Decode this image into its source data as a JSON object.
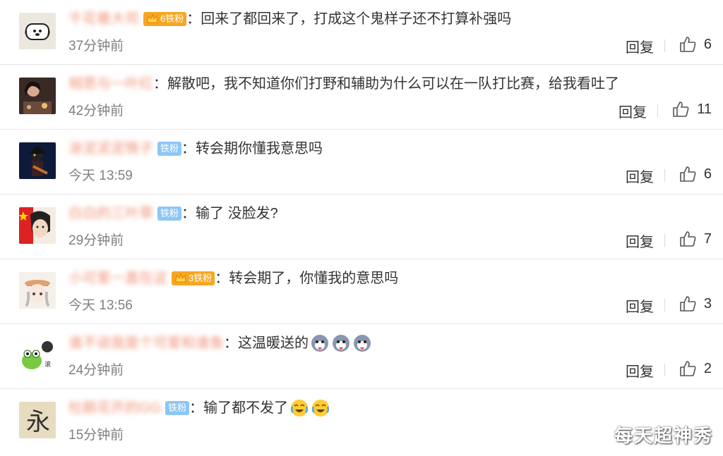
{
  "comments": [
    {
      "user": "千花巷大司",
      "badge": "铁粉",
      "badge_level": "6",
      "text": "：回来了都回来了，打成这个鬼样子还不打算补强吗",
      "time": "37分钟前",
      "reply": "回复",
      "likes": "6"
    },
    {
      "user": "相思与一叶红",
      "badge": "",
      "badge_level": "",
      "text": "：解散吧，我不知道你们打野和辅助为什么可以在一队打比赛，给我看吐了",
      "time": "42分钟前",
      "reply": "回复",
      "likes": "11"
    },
    {
      "user": "涂泥泥泥筷子",
      "badge": "铁粉",
      "badge_level": "",
      "text": "：转会期你懂我意思吗",
      "time": "今天 13:59",
      "reply": "回复",
      "likes": "6"
    },
    {
      "user": "白白的三叶草",
      "badge": "铁粉",
      "badge_level": "",
      "text": "：输了 没脸发?",
      "time": "29分钟前",
      "reply": "回复",
      "likes": "7"
    },
    {
      "user": "小可爱一直在这",
      "badge": "铁粉",
      "badge_level": "3",
      "text": "：转会期了，你懂我的意思吗",
      "time": "今天 13:56",
      "reply": "回复",
      "likes": "3"
    },
    {
      "user": "谁不说我是个可爱和谁鱼",
      "badge": "",
      "badge_level": "",
      "text": "：这温暖送的",
      "time": "24分钟前",
      "reply": "回复",
      "likes": "2"
    },
    {
      "user": "杜鹃花开的GG",
      "badge": "铁粉",
      "badge_level": "",
      "text": "：输了都不发了",
      "time": "15分钟前",
      "reply": "回复",
      "likes": ""
    }
  ],
  "watermark": "每天超神秀"
}
